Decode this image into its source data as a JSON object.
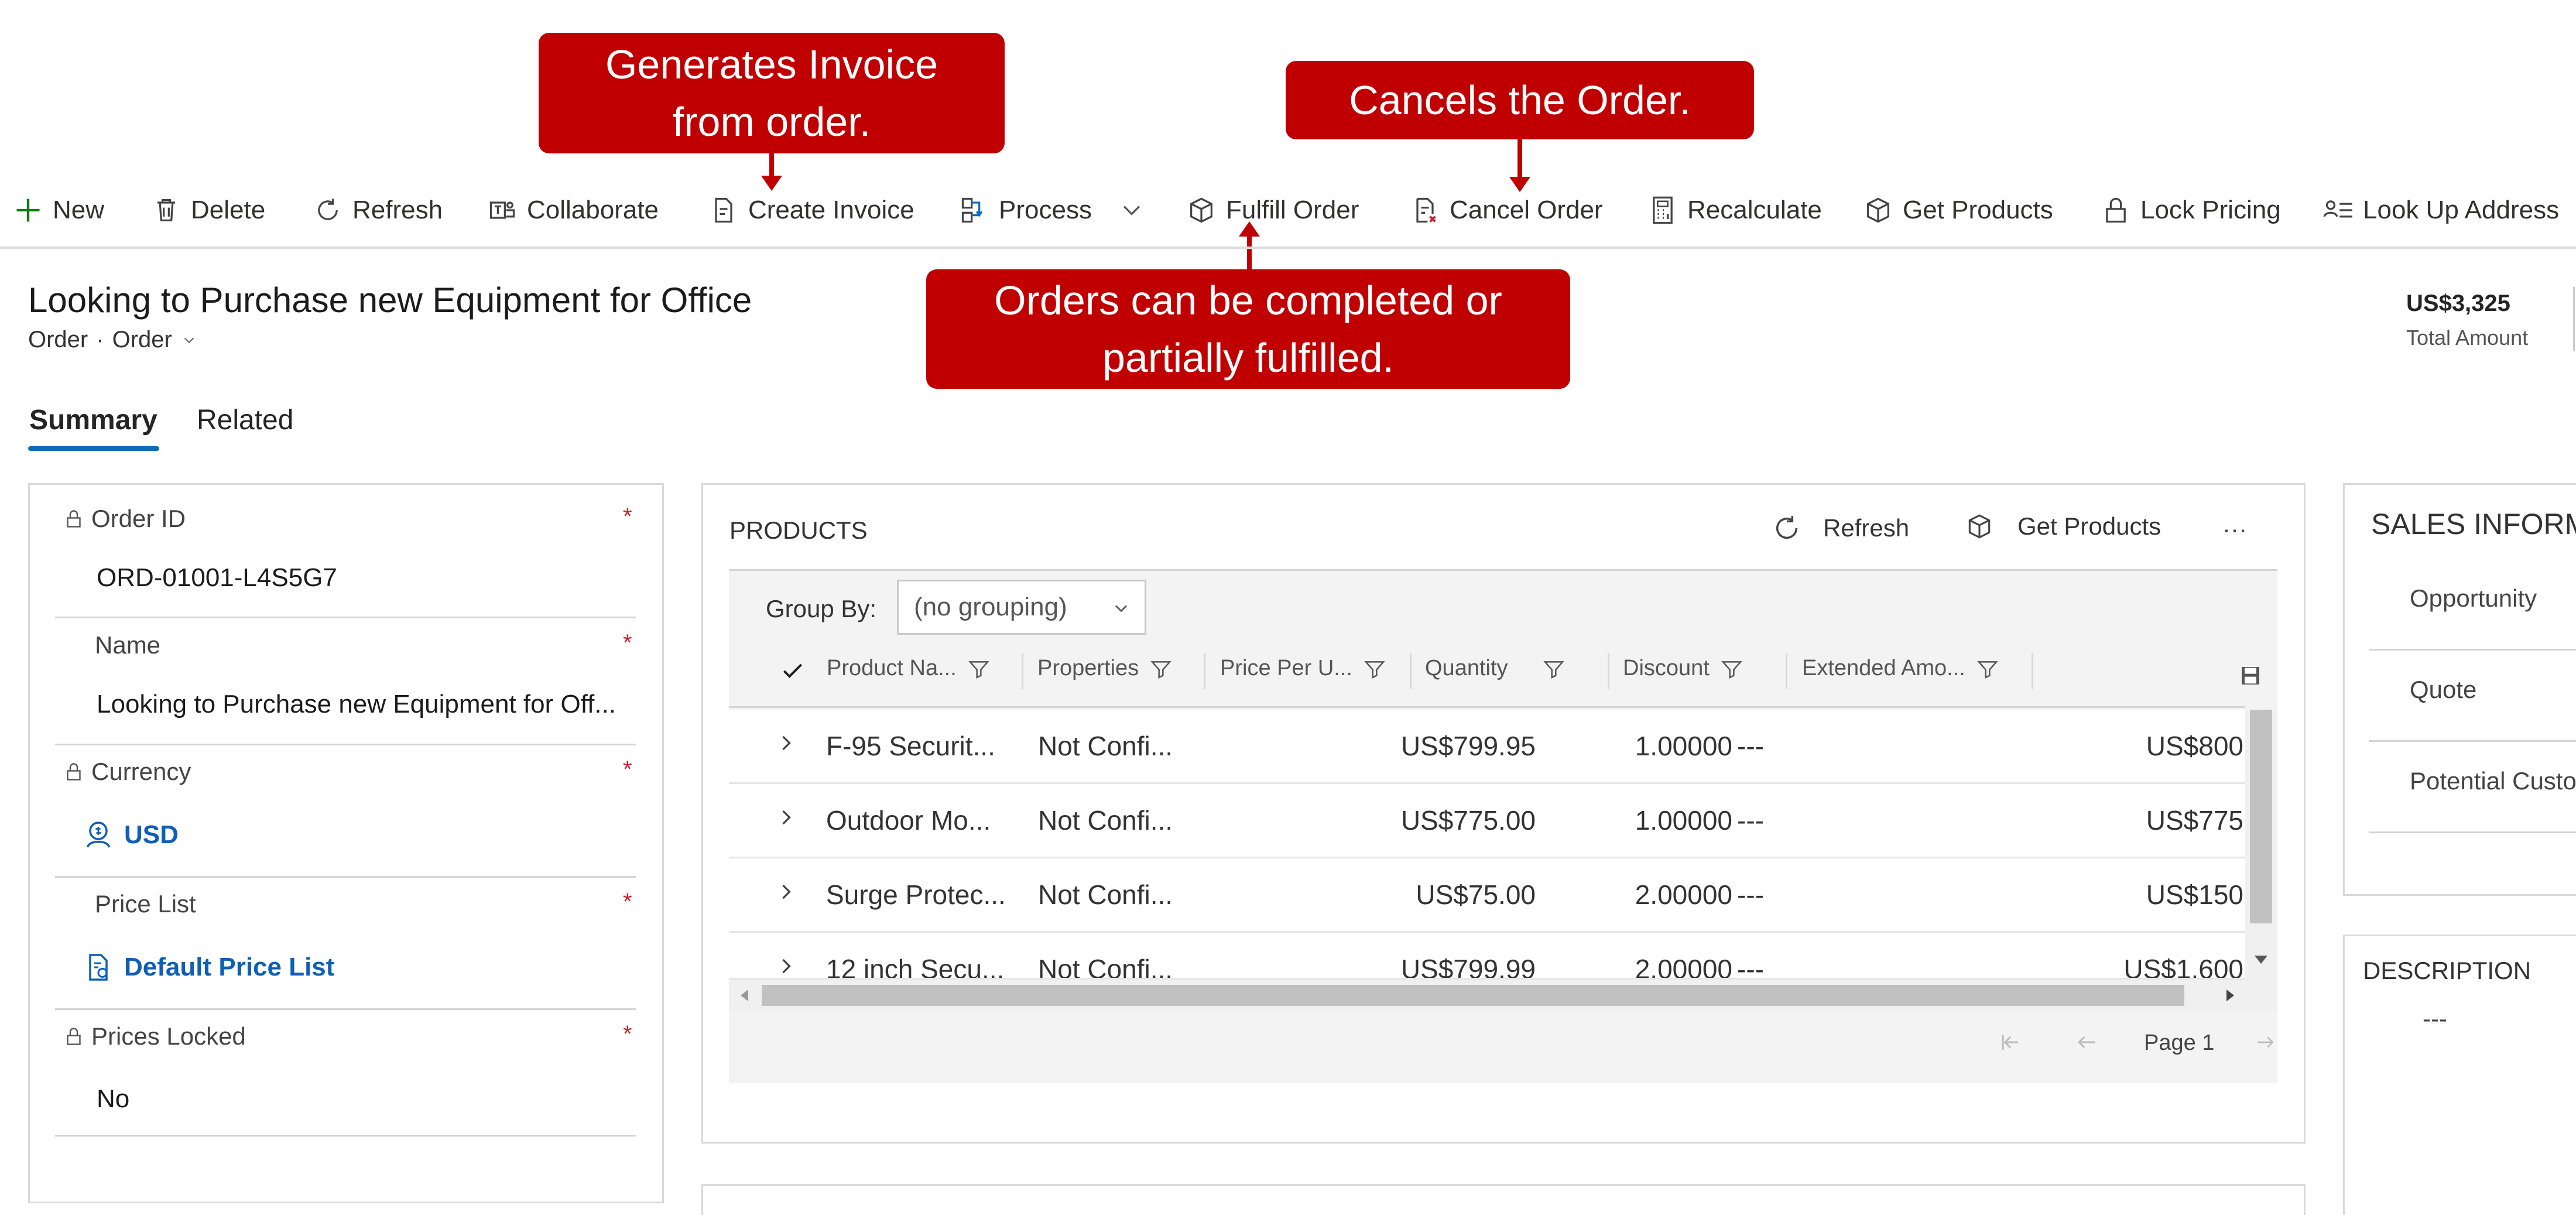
{
  "callouts": {
    "invoice": [
      "Generates Invoice",
      "from order."
    ],
    "cancel": [
      "Cancels the Order."
    ],
    "fulfill": [
      "Orders can be completed or",
      "partially fulfilled."
    ]
  },
  "commandbar": {
    "new": "New",
    "delete": "Delete",
    "refresh": "Refresh",
    "collaborate": "Collaborate",
    "create_invoice": "Create Invoice",
    "process": "Process",
    "fulfill_order": "Fulfill Order",
    "cancel_order": "Cancel Order",
    "recalculate": "Recalculate",
    "get_products": "Get Products",
    "lock_pricing": "Lock Pricing",
    "look_up_address": "Look Up Address"
  },
  "header": {
    "title": "Looking to Purchase new Equipment for Office",
    "entity": "Order",
    "separator": "·",
    "form": "Order",
    "total_amount_value": "US$3,325",
    "total_amount_label": "Total Amount"
  },
  "tabs": [
    "Summary",
    "Related"
  ],
  "summary_fields": {
    "order_id_label": "Order ID",
    "order_id_value": "ORD-01001-L4S5G7",
    "name_label": "Name",
    "name_value": "Looking to Purchase new Equipment for Off...",
    "currency_label": "Currency",
    "currency_value": "USD",
    "price_list_label": "Price List",
    "price_list_value": "Default Price List",
    "prices_locked_label": "Prices Locked",
    "prices_locked_value": "No",
    "required_mark": "*"
  },
  "products": {
    "title": "PRODUCTS",
    "refresh": "Refresh",
    "get_products": "Get Products",
    "more": "···",
    "group_by_label": "Group By:",
    "group_by_value": "(no grouping)",
    "columns": [
      "Product Na...",
      "Properties",
      "Price Per U...",
      "Quantity",
      "Discount",
      "Extended Amo..."
    ],
    "rows": [
      [
        "F-95 Securit...",
        "Not Confi...",
        "US$799.95",
        "1.00000",
        "---",
        "US$800"
      ],
      [
        "Outdoor Mo...",
        "Not Confi...",
        "US$775.00",
        "1.00000",
        "---",
        "US$775"
      ],
      [
        "Surge Protec...",
        "Not Confi...",
        "US$75.00",
        "2.00000",
        "---",
        "US$150"
      ],
      [
        "12 inch Secu...",
        "Not Confi...",
        "US$799.99",
        "2.00000",
        "---",
        "US$1,600"
      ]
    ],
    "page_label": "Page 1"
  },
  "sales_info": {
    "title": "SALES INFORM",
    "opportunity": "Opportunity",
    "quote": "Quote",
    "potential_customer": "Potential Custo"
  },
  "description": {
    "title": "DESCRIPTION",
    "value": "---"
  },
  "colors": {
    "callout": "#c00000",
    "accent_blue": "#0f6cbd",
    "link_blue": "#0f5fb5",
    "new_green": "#107c10",
    "required_red": "#c4262e"
  }
}
